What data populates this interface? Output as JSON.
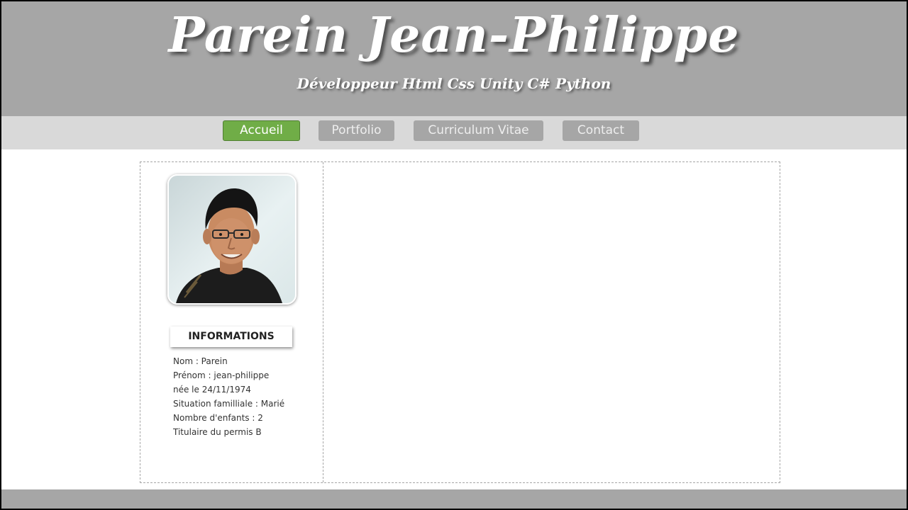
{
  "header": {
    "title": "Parein Jean-Philippe",
    "subtitle": "Développeur Html Css Unity C# Python"
  },
  "nav": {
    "items": [
      {
        "label": "Accueil",
        "active": true
      },
      {
        "label": "Portfolio",
        "active": false
      },
      {
        "label": "Curriculum Vitae",
        "active": false
      },
      {
        "label": "Contact",
        "active": false
      }
    ]
  },
  "sidebar": {
    "heading": "INFORMATIONS",
    "info": [
      "Nom : Parein",
      "Prénom : jean-philippe",
      "née le 24/11/1974",
      "Situation familliale : Marié",
      "Nombre d'enfants : 2",
      "Titulaire du permis B"
    ]
  },
  "colors": {
    "header_bg": "#a6a6a6",
    "nav_bg": "#d9d9d9",
    "active_button": "#70ad47",
    "inactive_button": "#a6a6a6"
  },
  "icons": {
    "photo": "profile-photo"
  }
}
